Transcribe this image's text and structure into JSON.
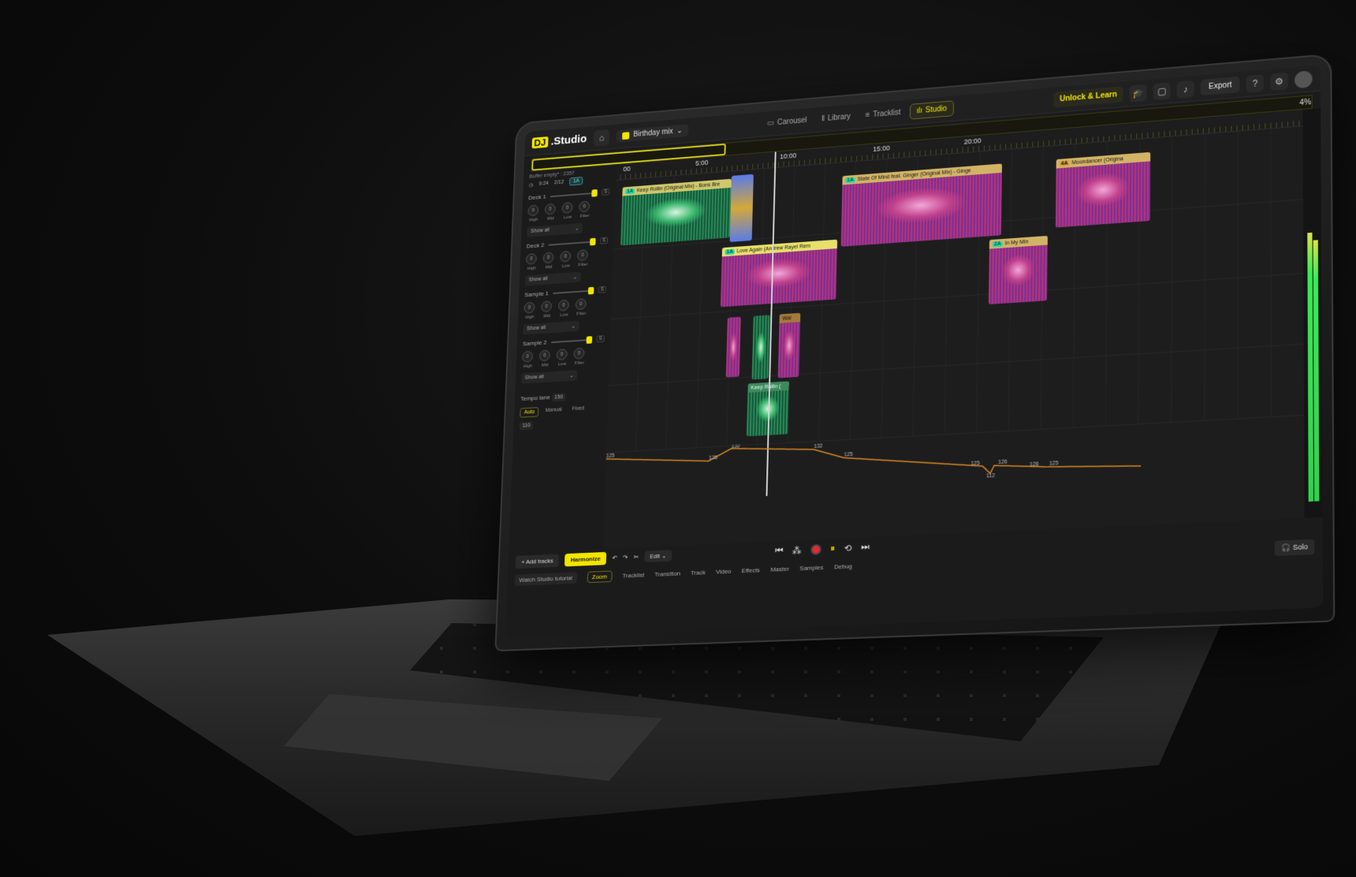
{
  "app": {
    "brand_dj": "DJ",
    "brand_name": ".Studio",
    "mix_name": "Birthday mix"
  },
  "nav": {
    "tabs": [
      {
        "label": "Carousel",
        "active": false
      },
      {
        "label": "Library",
        "active": false
      },
      {
        "label": "Tracklist",
        "active": false
      },
      {
        "label": "Studio",
        "active": true
      }
    ]
  },
  "toolbar": {
    "unlock": "Unlock & Learn",
    "export": "Export"
  },
  "timeline": {
    "buffer": "Buffer empty* : 2357",
    "time": "9:24",
    "bars": "2/12",
    "key": "1A",
    "ruler": [
      "00",
      "5:00",
      "10:00",
      "15:00",
      "20:00"
    ],
    "zoom_pct": "4%"
  },
  "decks": [
    {
      "name": "Deck 1",
      "knobs": [
        "High",
        "Mid",
        "Low",
        "Filter"
      ],
      "show_all": "Show all"
    },
    {
      "name": "Deck 2",
      "knobs": [
        "High",
        "Mid",
        "Low",
        "Filter"
      ],
      "show_all": "Show all"
    },
    {
      "name": "Sample 1",
      "knobs": [
        "High",
        "Mid",
        "Low",
        "Filter"
      ],
      "show_all": "Show all"
    },
    {
      "name": "Sample 2",
      "knobs": [
        "High",
        "Mid",
        "Low",
        "Filter"
      ],
      "show_all": "Show all"
    }
  ],
  "knob_value": "0",
  "tempo_lane": {
    "label": "Tempo lane",
    "max": "150",
    "min": "110",
    "modes": [
      "Auto",
      "Manual",
      "Fixed"
    ],
    "points": [
      "125",
      "125",
      "132",
      "132",
      "125",
      "125",
      "126",
      "126",
      "125",
      "112"
    ]
  },
  "clips": [
    {
      "key": "1A",
      "title": "Keep Rollin (Original Mix) - Bons Bre"
    },
    {
      "key": "1A",
      "title": "State Of Mind feat. Ginger (Original Mix) - Ginge"
    },
    {
      "key": "4A",
      "title": "Moondancer (Origina"
    },
    {
      "key": "1A",
      "title": "Love Again (Andrew Rayel Rem"
    },
    {
      "key": "2A",
      "title": "In My Min"
    },
    {
      "key": "",
      "title": "Keep Rollin ("
    },
    {
      "key": "",
      "title": "Wal"
    }
  ],
  "bottom": {
    "add_tracks": "Add tracks",
    "harmonize": "Harmonize",
    "edit": "Edit",
    "tutorial": "Watch Studio tutorial",
    "tabs": [
      "Zoom",
      "Tracklist",
      "Transition",
      "Track",
      "Video",
      "Effects",
      "Master",
      "Samples",
      "Debug"
    ],
    "solo": "Solo"
  },
  "colors": {
    "accent": "#f2e600",
    "wave_pink": "#c0418c",
    "wave_green": "#37b36a",
    "record": "#e02a3a"
  }
}
